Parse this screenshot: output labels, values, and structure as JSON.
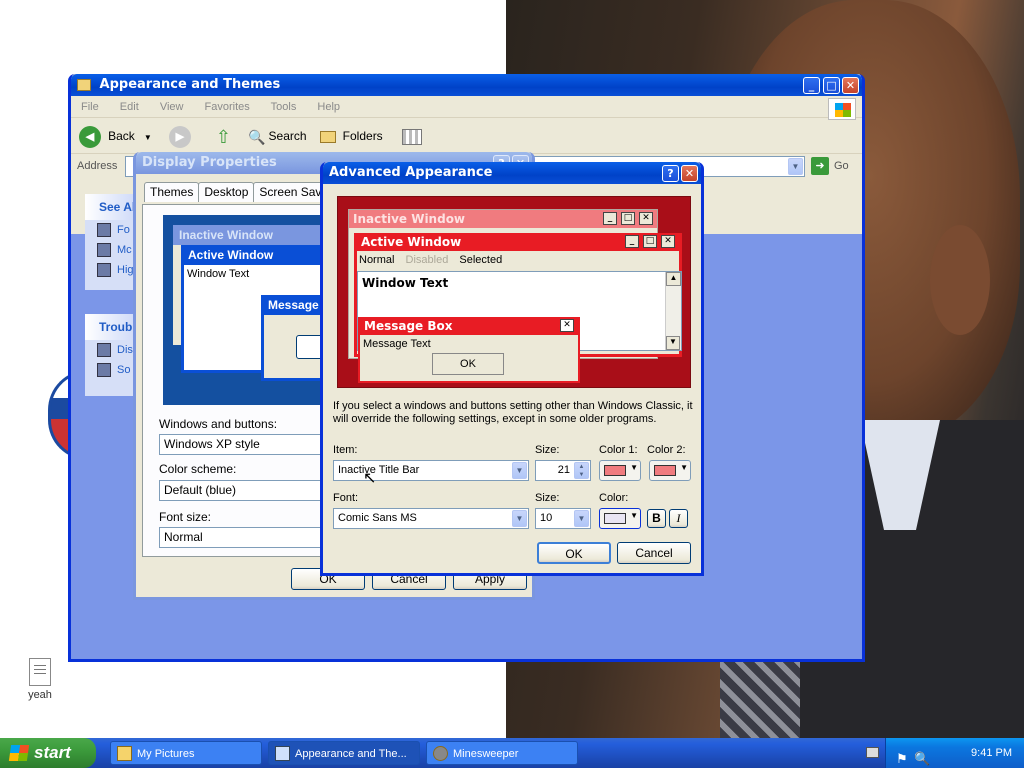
{
  "explorer": {
    "title": "Appearance and Themes",
    "menu": [
      "File",
      "Edit",
      "View",
      "Favorites",
      "Tools",
      "Help"
    ],
    "toolbar": {
      "back": "Back",
      "search": "Search",
      "folders": "Folders"
    },
    "address_label": "Address",
    "go_label": "Go",
    "panel1": {
      "title": "See Al",
      "items": [
        "Fo",
        "Mc",
        "Hig"
      ]
    },
    "panel2": {
      "title": "Troubl",
      "items": [
        "Dis",
        "So"
      ]
    }
  },
  "display": {
    "title": "Display Properties",
    "tabs": [
      "Themes",
      "Desktop",
      "Screen Saver"
    ],
    "preview": {
      "inactive": "Inactive Window",
      "active": "Active Window",
      "window_text": "Window Text",
      "message": "Message"
    },
    "windows_buttons_label": "Windows and buttons:",
    "windows_buttons_value": "Windows XP style",
    "color_scheme_label": "Color scheme:",
    "color_scheme_value": "Default (blue)",
    "font_size_label": "Font size:",
    "font_size_value": "Normal",
    "ok": "OK",
    "cancel": "Cancel",
    "apply": "Apply"
  },
  "advanced": {
    "title": "Advanced Appearance",
    "preview": {
      "inactive": "Inactive Window",
      "active": "Active Window",
      "normal": "Normal",
      "disabled": "Disabled",
      "selected": "Selected",
      "window_text": "Window Text",
      "message_box": "Message Box",
      "message_text": "Message Text",
      "ok": "OK"
    },
    "note": "If you select a windows and buttons setting other than Windows Classic, it will override the following settings, except in some older programs.",
    "item_label": "Item:",
    "item_value": "Inactive Title Bar",
    "size_label": "Size:",
    "size_value": "21",
    "color1_label": "Color 1:",
    "color2_label": "Color 2:",
    "font_label": "Font:",
    "font_value": "Comic Sans MS",
    "font_size_label": "Size:",
    "font_size_value": "10",
    "color_label": "Color:",
    "bold": "B",
    "italic": "I",
    "ok": "OK",
    "cancel": "Cancel"
  },
  "desktop": {
    "icon_label": "yeah"
  },
  "taskbar": {
    "start": "start",
    "tasks": [
      "My Pictures",
      "Appearance and The...",
      "Minesweeper"
    ],
    "clock": "9:41 PM"
  },
  "colors": {
    "title_red": "#e81c24",
    "inactive_pink": "#f07b7f",
    "xp_blue": "#0831d9",
    "preview_dark_red": "#a90e18"
  }
}
